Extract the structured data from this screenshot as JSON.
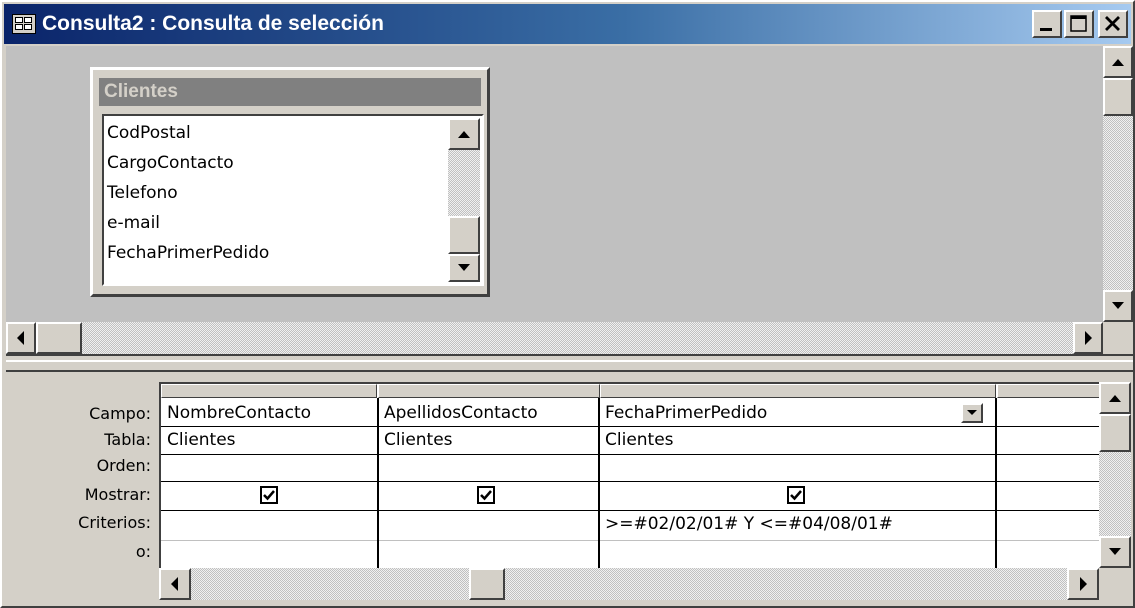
{
  "window": {
    "title": "Consulta2 : Consulta de selección",
    "controls": [
      "minimize-icon",
      "maximize-icon",
      "close-icon"
    ]
  },
  "table_box": {
    "title": "Clientes",
    "fields": [
      "CodPostal",
      "CargoContacto",
      "Telefono",
      "e-mail",
      "FechaPrimerPedido"
    ]
  },
  "grid": {
    "row_labels": [
      "Campo:",
      "Tabla:",
      "Orden:",
      "Mostrar:",
      "Criterios:",
      "o:"
    ],
    "columns": [
      {
        "campo": "NombreContacto",
        "tabla": "Clientes",
        "orden": "",
        "mostrar": true,
        "criterios": "",
        "o": ""
      },
      {
        "campo": "ApellidosContacto",
        "tabla": "Clientes",
        "orden": "",
        "mostrar": true,
        "criterios": "",
        "o": ""
      },
      {
        "campo": "FechaPrimerPedido",
        "tabla": "Clientes",
        "orden": "",
        "mostrar": true,
        "criterios": ">=#02/02/01# Y <=#04/08/01#",
        "o": ""
      }
    ]
  },
  "colors": {
    "title_gradient_start": "#0a246a",
    "title_gradient_end": "#a6caf0",
    "face": "#d4d0c8",
    "pane": "#c0c0c0"
  }
}
